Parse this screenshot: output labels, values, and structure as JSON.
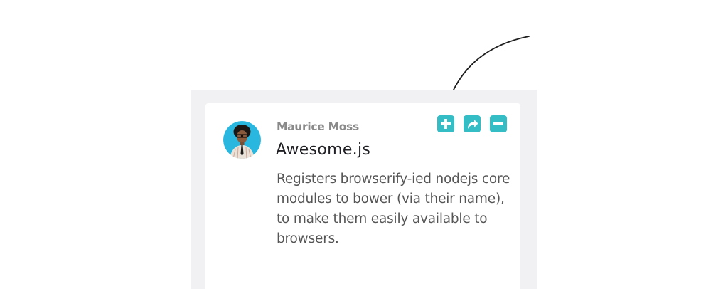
{
  "card": {
    "author": "Maurice Moss",
    "title": "Awesome.js",
    "description": "Registers browserify-ied nodejs core modules to bower (via their name), to make them easily available to browsers.",
    "avatar_alt": "Maurice Moss avatar"
  },
  "actions": [
    {
      "icon": "plus-icon",
      "label": "Add"
    },
    {
      "icon": "share-icon",
      "label": "Share"
    },
    {
      "icon": "minus-icon",
      "label": "Remove"
    }
  ],
  "colors": {
    "accent": "#35bdc6",
    "frame": "#f1f1f3",
    "author": "#8a8a8a",
    "title": "#1f1f24",
    "text": "#555555"
  }
}
